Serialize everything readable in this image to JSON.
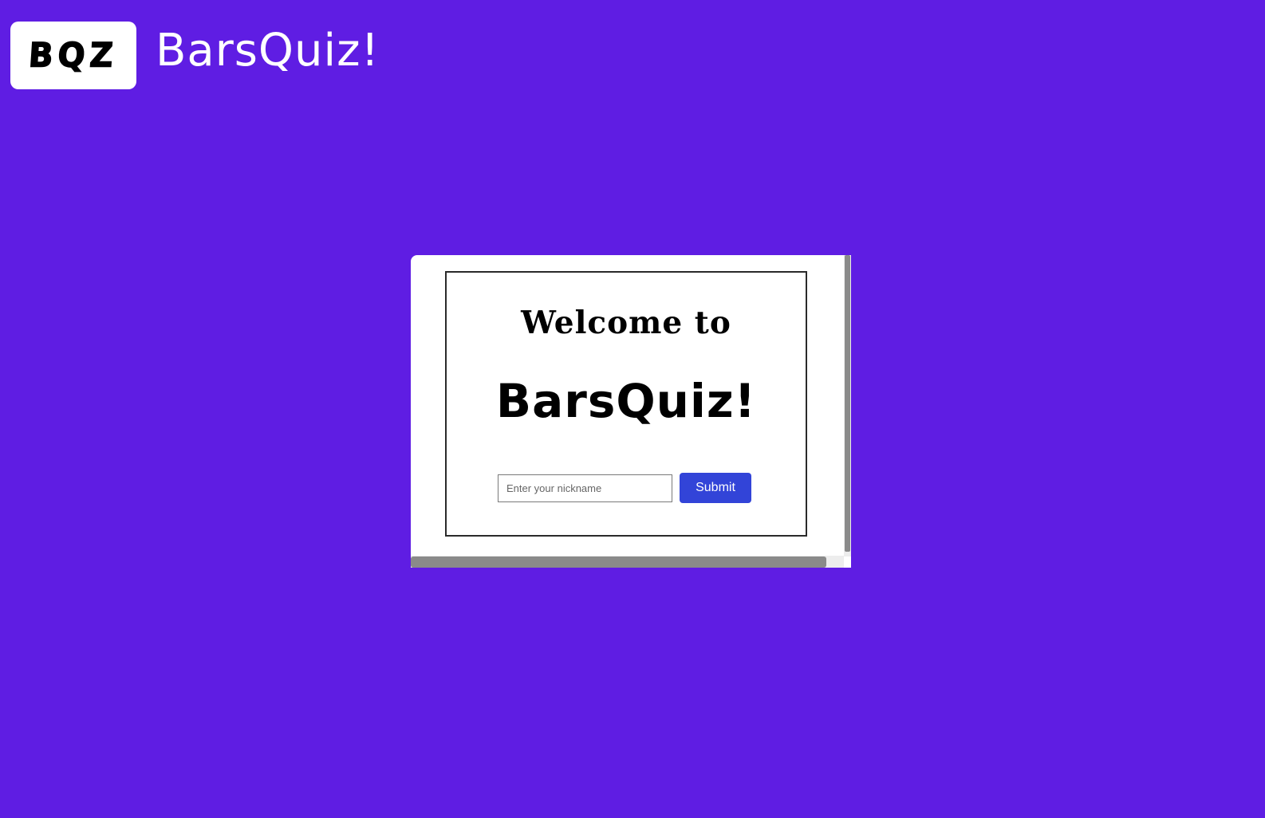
{
  "header": {
    "badge_text": "BQZ",
    "brand_title": "BarsQuiz!"
  },
  "modal": {
    "welcome_text": "Welcome to",
    "brand_text": "BarsQuiz!",
    "nickname_input": {
      "placeholder": "Enter your nickname",
      "value": ""
    },
    "submit_label": "Submit"
  },
  "colors": {
    "background": "#5f1de3",
    "submit_button": "#3244d8",
    "panel": "#ffffff"
  }
}
